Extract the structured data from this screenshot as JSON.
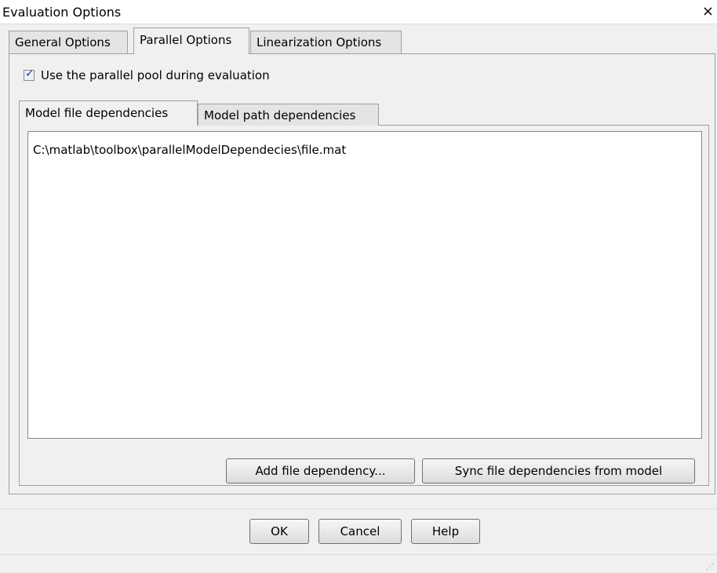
{
  "window": {
    "title": "Evaluation Options",
    "close_glyph": "×"
  },
  "tabs": [
    {
      "label": "General Options",
      "active": false
    },
    {
      "label": "Parallel Options",
      "active": true
    },
    {
      "label": "Linearization Options",
      "active": false
    }
  ],
  "parallel": {
    "use_pool_label": "Use the parallel pool during evaluation",
    "use_pool_checked": true
  },
  "inner_tabs": [
    {
      "label": "Model file dependencies",
      "active": true
    },
    {
      "label": "Model path dependencies",
      "active": false
    }
  ],
  "file_dependencies": [
    "C:\\matlab\\toolbox\\parallelModelDependecies\\file.mat"
  ],
  "panel_buttons": {
    "add": "Add file dependency...",
    "sync": "Sync file dependencies from model"
  },
  "footer_buttons": {
    "ok": "OK",
    "cancel": "Cancel",
    "help": "Help"
  },
  "colors": {
    "background": "#f0f0f0",
    "border": "#a0a0a0",
    "checkmark": "#1c3f8a"
  },
  "icons": {
    "checkbox": "check-icon",
    "close": "close-icon",
    "resize": "resize-grip-icon"
  }
}
